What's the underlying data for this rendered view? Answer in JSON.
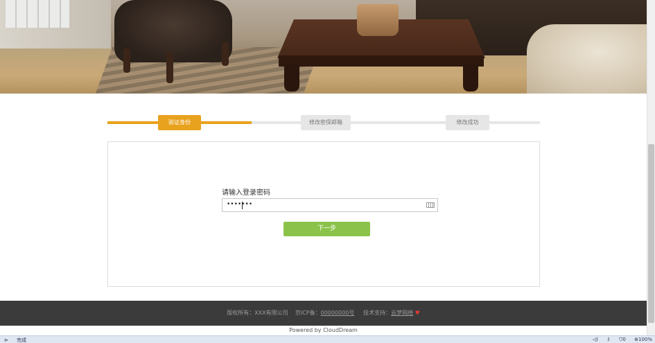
{
  "steps": [
    {
      "label": "验证身份"
    },
    {
      "label": "修改密保邮箱"
    },
    {
      "label": "修改成功"
    }
  ],
  "form": {
    "password_label": "请输入登录密码",
    "password_value": "•••••••",
    "next_button": "下一步"
  },
  "footer": {
    "copyright": "版权所有：XXX有限公司",
    "icp_prefix": "京ICP备：",
    "icp_number": "00000000号",
    "support_prefix": "技术支持：",
    "support_link": "云梦网络",
    "powered": "Powered by CloudDream"
  },
  "statusbar": {
    "status_text": "完成",
    "counter": "0",
    "zoom": "100%"
  },
  "colors": {
    "accent": "#e8a21e",
    "button": "#8bc34a",
    "footer_bg": "#3b3b3b"
  }
}
